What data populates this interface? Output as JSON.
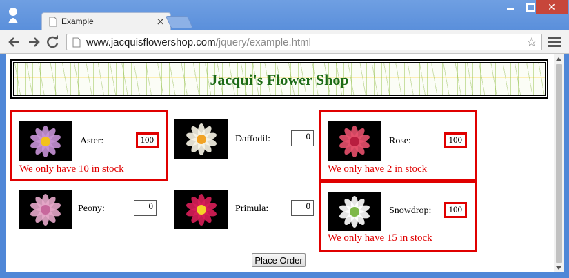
{
  "browser": {
    "tab_title": "Example",
    "tab_close": "×",
    "url_host": "www.jacquisflowershop.com",
    "url_path": "/jquery/example.html",
    "star": "☆",
    "close": "✕"
  },
  "page": {
    "title": "Jacqui's Flower Shop",
    "order_button": "Place Order",
    "products": [
      {
        "name": "Aster:",
        "quantity": "100",
        "stock_message": "We only have 10 in stock",
        "low_stock": true,
        "flower_color": "#c792d6",
        "center_color": "#f3c21d"
      },
      {
        "name": "Daffodil:",
        "quantity": "0",
        "stock_message": "",
        "low_stock": false,
        "flower_color": "#f7f4e6",
        "center_color": "#f1a326"
      },
      {
        "name": "Rose:",
        "quantity": "100",
        "stock_message": "We only have 2 in stock",
        "low_stock": true,
        "flower_color": "#e6506b",
        "center_color": "#b81e3f"
      },
      {
        "name": "Peony:",
        "quantity": "0",
        "stock_message": "",
        "low_stock": false,
        "flower_color": "#e5a7c9",
        "center_color": "#c7689c"
      },
      {
        "name": "Primula:",
        "quantity": "0",
        "stock_message": "",
        "low_stock": false,
        "flower_color": "#d91e58",
        "center_color": "#f5d327"
      },
      {
        "name": "Snowdrop:",
        "quantity": "100",
        "stock_message": "We only have 15 in stock",
        "low_stock": true,
        "flower_color": "#ffffff",
        "center_color": "#7fb84a"
      }
    ]
  }
}
